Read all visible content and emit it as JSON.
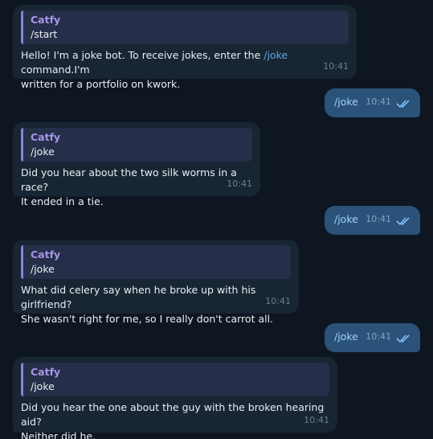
{
  "colors": {
    "background": "#0e1621",
    "incoming_bubble": "#182533",
    "outgoing_bubble": "#2b5278",
    "reply_bar": "#8f7ed8",
    "reply_name": "#a695e7",
    "link": "#5fa8e4"
  },
  "messages": [
    {
      "reply_name": "Catfy",
      "reply_text": "/start",
      "text_before": "Hello! I'm a joke bot. To receive jokes, enter the ",
      "link": "/joke",
      "text_after": " command.I'm\nwritten for a portfolio on kwork.",
      "time": "10:41"
    },
    {
      "out_text": "/joke",
      "time": "10:41",
      "status_icon": "double-check-icon"
    },
    {
      "reply_name": "Catfy",
      "reply_text": "/joke",
      "text": "Did you hear about the two silk worms in a race?\nIt ended in a tie.",
      "time": "10:41"
    },
    {
      "out_text": "/joke",
      "time": "10:41",
      "status_icon": "double-check-icon"
    },
    {
      "reply_name": "Catfy",
      "reply_text": "/joke",
      "text": "What did celery say when he broke up with his girlfriend?\nShe wasn't right for me, so I really don't carrot all.",
      "time": "10:41"
    },
    {
      "out_text": "/joke",
      "time": "10:41",
      "status_icon": "double-check-icon"
    },
    {
      "reply_name": "Catfy",
      "reply_text": "/joke",
      "text": "Did you hear the one about the guy with the broken hearing aid?\nNeither did he.",
      "time": "10:41"
    }
  ]
}
